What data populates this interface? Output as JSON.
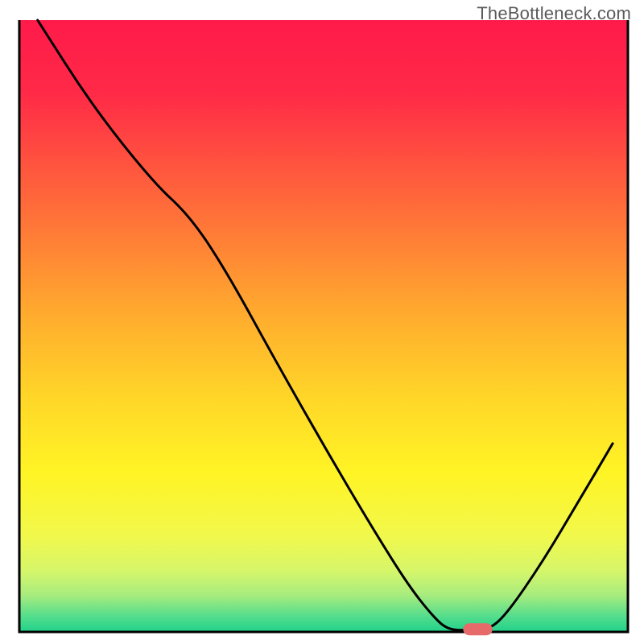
{
  "watermark": "TheBottleneck.com",
  "chart_data": {
    "type": "line",
    "title": "",
    "xlabel": "",
    "ylabel": "",
    "xlim": [
      0,
      100
    ],
    "ylim": [
      0,
      100
    ],
    "gradient_stops": [
      {
        "offset": 0.0,
        "color": "#ff1a4a"
      },
      {
        "offset": 0.12,
        "color": "#ff2a47"
      },
      {
        "offset": 0.3,
        "color": "#ff6a3a"
      },
      {
        "offset": 0.48,
        "color": "#ffab2e"
      },
      {
        "offset": 0.62,
        "color": "#ffd728"
      },
      {
        "offset": 0.74,
        "color": "#fff425"
      },
      {
        "offset": 0.84,
        "color": "#f2f84a"
      },
      {
        "offset": 0.9,
        "color": "#d6f66a"
      },
      {
        "offset": 0.94,
        "color": "#a8ec7e"
      },
      {
        "offset": 0.975,
        "color": "#52dd8c"
      },
      {
        "offset": 1.0,
        "color": "#20d18a"
      }
    ],
    "curve_points": [
      {
        "x": 3.0,
        "y": 100.0
      },
      {
        "x": 12.0,
        "y": 86.0
      },
      {
        "x": 22.0,
        "y": 73.5
      },
      {
        "x": 28.0,
        "y": 68.0
      },
      {
        "x": 34.0,
        "y": 59.0
      },
      {
        "x": 42.0,
        "y": 44.5
      },
      {
        "x": 50.0,
        "y": 30.5
      },
      {
        "x": 58.0,
        "y": 17.0
      },
      {
        "x": 64.0,
        "y": 7.5
      },
      {
        "x": 68.0,
        "y": 2.5
      },
      {
        "x": 70.5,
        "y": 0.3
      },
      {
        "x": 74.0,
        "y": 0.3
      },
      {
        "x": 77.0,
        "y": 0.3
      },
      {
        "x": 80.0,
        "y": 2.8
      },
      {
        "x": 86.0,
        "y": 11.5
      },
      {
        "x": 92.0,
        "y": 21.5
      },
      {
        "x": 97.5,
        "y": 30.8
      }
    ],
    "marker": {
      "x": 73.2,
      "y": 0.3,
      "width": 4.8,
      "height": 1.7,
      "color": "#e66a6a"
    },
    "frame": {
      "x0": 3.0,
      "y0": 0.0,
      "x1": 97.5,
      "y1": 100.0,
      "color": "#000000",
      "width": 3
    }
  }
}
